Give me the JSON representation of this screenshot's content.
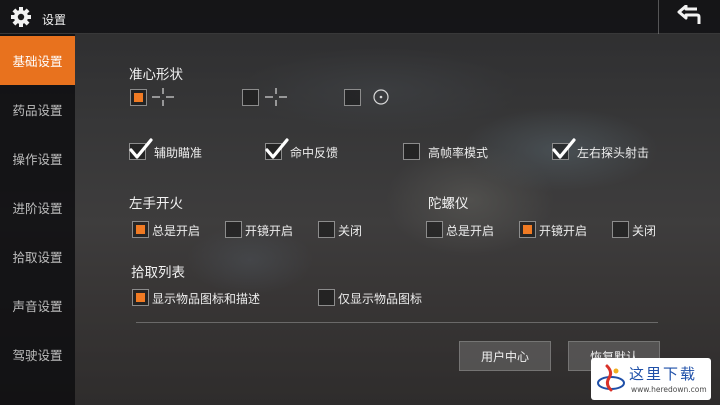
{
  "header": {
    "title": "设置",
    "back_icon": "return-arrow-icon",
    "settings_icon": "gear-icon"
  },
  "sidebar": {
    "items": [
      {
        "label": "基础设置",
        "active": true
      },
      {
        "label": "药品设置",
        "active": false
      },
      {
        "label": "操作设置",
        "active": false
      },
      {
        "label": "进阶设置",
        "active": false
      },
      {
        "label": "拾取设置",
        "active": false
      },
      {
        "label": "声音设置",
        "active": false
      },
      {
        "label": "驾驶设置",
        "active": false
      }
    ]
  },
  "crosshair": {
    "label": "准心形状",
    "options": [
      {
        "icon": "crosshair-cross-icon",
        "selected": true
      },
      {
        "icon": "crosshair-cross-icon",
        "selected": false
      },
      {
        "icon": "crosshair-circle-dot-icon",
        "selected": false
      }
    ]
  },
  "toggles": [
    {
      "label": "辅助瞄准",
      "checked": true
    },
    {
      "label": "命中反馈",
      "checked": true
    },
    {
      "label": "高帧率模式",
      "checked": false
    },
    {
      "label": "左右探头射击",
      "checked": true
    }
  ],
  "left_fire": {
    "label": "左手开火",
    "options": [
      {
        "label": "总是开启",
        "selected": true
      },
      {
        "label": "开镜开启",
        "selected": false
      },
      {
        "label": "关闭",
        "selected": false
      }
    ]
  },
  "gyroscope": {
    "label": "陀螺仪",
    "options": [
      {
        "label": "总是开启",
        "selected": false
      },
      {
        "label": "开镜开启",
        "selected": true
      },
      {
        "label": "关闭",
        "selected": false
      }
    ]
  },
  "pickup_list": {
    "label": "拾取列表",
    "options": [
      {
        "label": "显示物品图标和描述",
        "selected": true
      },
      {
        "label": "仅显示物品图标",
        "selected": false
      }
    ]
  },
  "buttons": {
    "user_center": "用户中心",
    "restore_default": "恢复默认"
  },
  "watermark": {
    "text": "这里下载",
    "url": "www.heredown.com"
  },
  "colors": {
    "accent": "#e8721e",
    "selected_fill": "#f07a23"
  }
}
